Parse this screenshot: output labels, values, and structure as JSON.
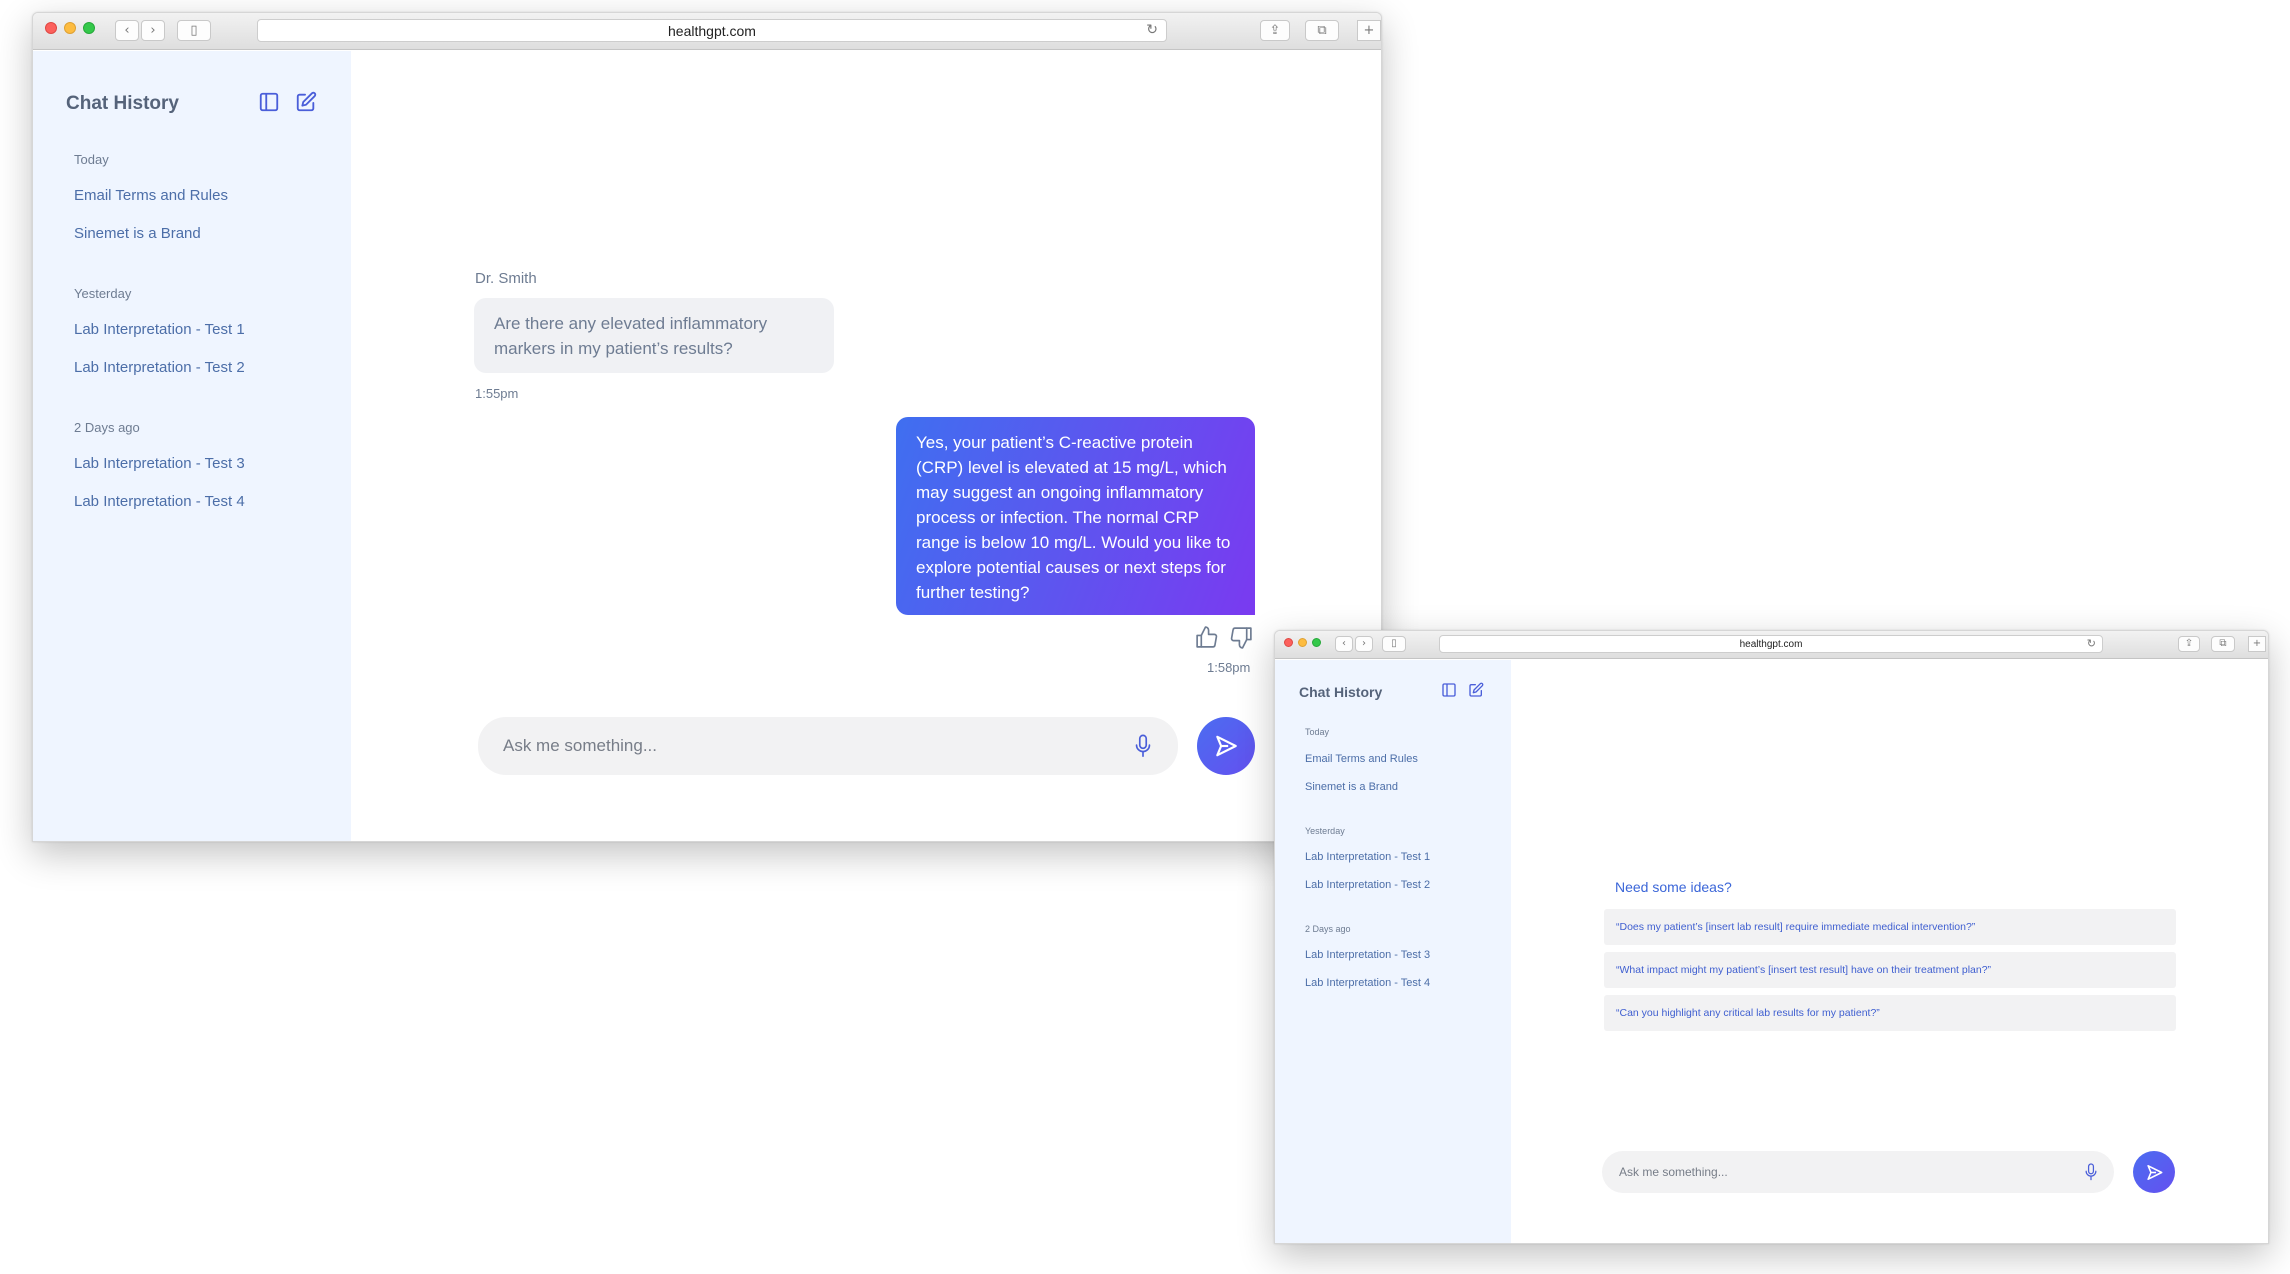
{
  "browser": {
    "url": "healthgpt.com"
  },
  "sidebar": {
    "title": "Chat History",
    "groups": [
      {
        "label": "Today",
        "items": [
          "Email Terms and Rules",
          "Sinemet is a Brand"
        ]
      },
      {
        "label": "Yesterday",
        "items": [
          "Lab Interpretation - Test 1",
          "Lab Interpretation - Test 2"
        ]
      },
      {
        "label": "2 Days ago",
        "items": [
          "Lab Interpretation - Test 3",
          "Lab Interpretation - Test 4"
        ]
      }
    ]
  },
  "chat": {
    "sender": "Dr. Smith",
    "user_message": "Are there any elevated inflammatory markers in my patient’s results?",
    "user_time": "1:55pm",
    "ai_message": "Yes, your patient’s C-reactive protein (CRP) level is elevated at 15 mg/L, which may suggest an ongoing inflammatory process or infection. The normal CRP range is below 10 mg/L. Would you like to explore potential causes or next steps for further testing?",
    "ai_time": "1:58pm"
  },
  "composer": {
    "placeholder": "Ask me something..."
  },
  "ideas": {
    "title": "Need some ideas?",
    "items": [
      "“Does my patient’s [insert lab result] require immediate medical intervention?”",
      "“What impact might my patient’s [insert test result] have on their treatment plan?”",
      "“Can you highlight any critical lab results for my patient?”"
    ]
  },
  "colors": {
    "accent": "#4a5ed9",
    "sidebar_bg": "#eff5ff",
    "ai_bubble_gradient": [
      "#3f6ff0",
      "#7a3af0"
    ]
  },
  "icons": [
    "sidebar-toggle-icon",
    "new-chat-icon",
    "thumbs-up-icon",
    "thumbs-down-icon",
    "microphone-icon",
    "send-icon"
  ]
}
